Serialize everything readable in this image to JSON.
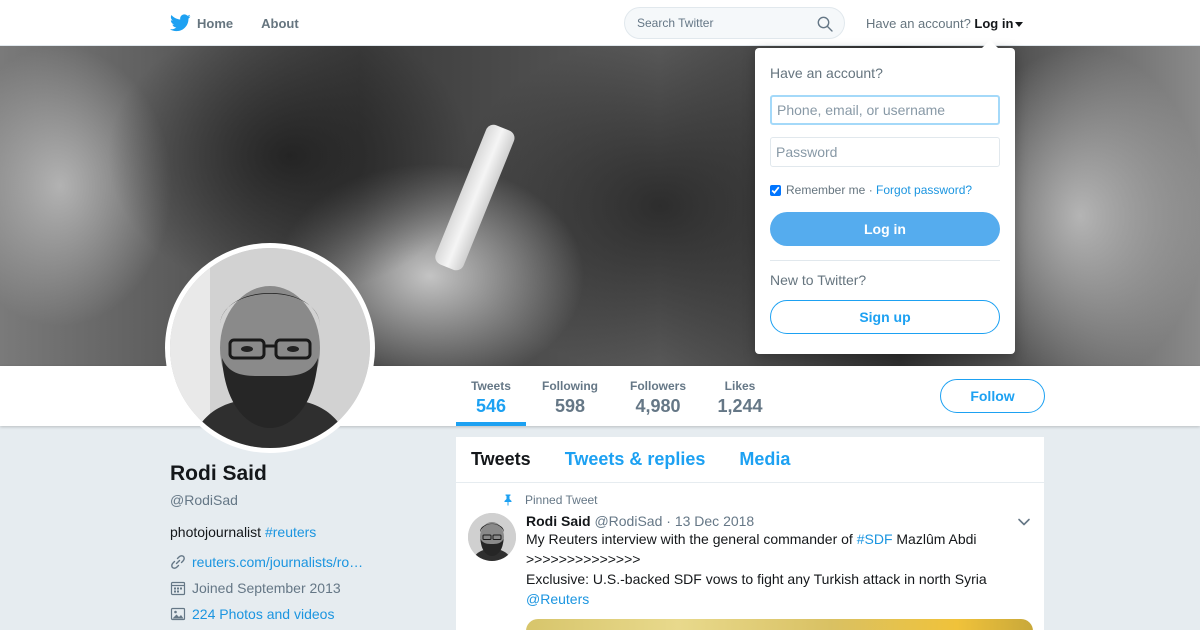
{
  "nav": {
    "home_label": "Home",
    "about_label": "About",
    "search_placeholder": "Search Twitter",
    "account_prompt": "Have an account?",
    "login_label": "Log in"
  },
  "profile": {
    "name": "Rodi Said",
    "handle": "@RodiSad",
    "bio_text": "photojournalist",
    "bio_hashtag": "#reuters",
    "website": "reuters.com/journalists/ro…",
    "joined": "Joined September 2013",
    "photos_videos": "224 Photos and videos"
  },
  "stats": [
    {
      "label": "Tweets",
      "value": "546",
      "active": true
    },
    {
      "label": "Following",
      "value": "598"
    },
    {
      "label": "Followers",
      "value": "4,980"
    },
    {
      "label": "Likes",
      "value": "1,244"
    }
  ],
  "follow_label": "Follow",
  "timeline": {
    "tabs": [
      "Tweets",
      "Tweets & replies",
      "Media"
    ],
    "tweet": {
      "pinned_label": "Pinned Tweet",
      "fullname": "Rodi Said",
      "handle": "@RodiSad",
      "separator": "·",
      "date": "13 Dec 2018",
      "line1_before": "My Reuters interview with the general commander of ",
      "line1_hashtag": "#SDF",
      "line1_after": " Mazlûm Abdi",
      "line2": ">>>>>>>>>>>>>>",
      "line3": "Exclusive: U.S.-backed SDF vows to fight any Turkish attack in north Syria",
      "mention": "@Reuters"
    }
  },
  "login_dropdown": {
    "heading": "Have an account?",
    "username_placeholder": "Phone, email, or username",
    "password_placeholder": "Password",
    "remember_label": "Remember me",
    "separator": " · ",
    "forgot_label": "Forgot password?",
    "login_button": "Log in",
    "new_prompt": "New to Twitter?",
    "signup_button": "Sign up"
  },
  "colors": {
    "accent": "#1da1f2",
    "link": "#1b95e0",
    "login_button": "#55acee",
    "background": "#e6ecf0"
  },
  "icons": [
    "twitter-bird-icon",
    "home-icon",
    "search-icon",
    "caret-down-icon",
    "pin-icon",
    "link-icon",
    "calendar-icon",
    "image-icon",
    "chevron-down-icon"
  ]
}
